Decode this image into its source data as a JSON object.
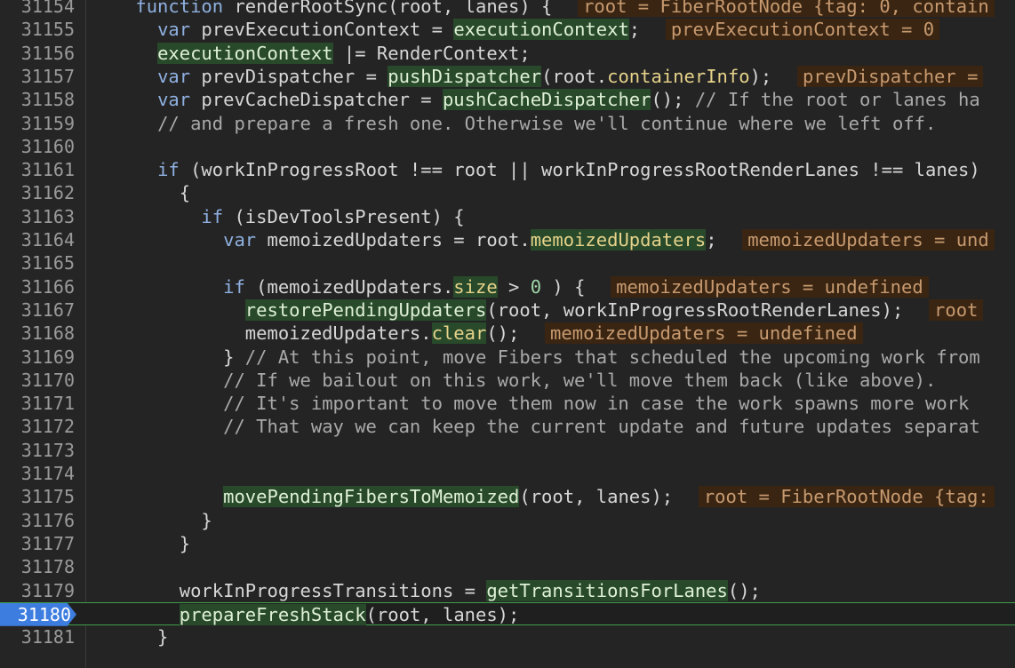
{
  "editor": {
    "current_line": "31180",
    "lines": [
      {
        "n": "31154",
        "segs": [
          [
            "",
            "    "
          ],
          [
            "kw",
            "function"
          ],
          [
            "",
            " renderRootSync(root, lanes) {  "
          ],
          [
            "ann",
            "root = FiberRootNode {tag: 0, contain"
          ]
        ]
      },
      {
        "n": "31155",
        "segs": [
          [
            "",
            "      "
          ],
          [
            "kw",
            "var"
          ],
          [
            "",
            " prevExecutionContext = "
          ],
          [
            "hl",
            "executionContext"
          ],
          [
            "",
            ";  "
          ],
          [
            "ann",
            "prevExecutionContext = 0"
          ]
        ]
      },
      {
        "n": "31156",
        "segs": [
          [
            "",
            "      "
          ],
          [
            "hl",
            "executionContext"
          ],
          [
            "",
            " |= RenderContext;"
          ]
        ]
      },
      {
        "n": "31157",
        "segs": [
          [
            "",
            "      "
          ],
          [
            "kw",
            "var"
          ],
          [
            "",
            " prevDispatcher = "
          ],
          [
            "hl",
            "pushDispatcher"
          ],
          [
            "",
            "(root."
          ],
          [
            "pr",
            "containerInfo"
          ],
          [
            "",
            ");  "
          ],
          [
            "ann",
            "prevDispatcher ="
          ]
        ]
      },
      {
        "n": "31158",
        "segs": [
          [
            "",
            "      "
          ],
          [
            "kw",
            "var"
          ],
          [
            "",
            " prevCacheDispatcher = "
          ],
          [
            "hl",
            "pushCacheDispatcher"
          ],
          [
            "",
            "(); "
          ],
          [
            "cm",
            "// If the root or lanes ha"
          ]
        ]
      },
      {
        "n": "31159",
        "segs": [
          [
            "",
            "      "
          ],
          [
            "cm",
            "// and prepare a fresh one. Otherwise we'll continue where we left off."
          ]
        ]
      },
      {
        "n": "31160",
        "segs": []
      },
      {
        "n": "31161",
        "segs": [
          [
            "",
            "      "
          ],
          [
            "kw",
            "if"
          ],
          [
            "",
            " (workInProgressRoot !== root || workInProgressRootRenderLanes !== lanes)"
          ]
        ]
      },
      {
        "n": "31162",
        "segs": [
          [
            "",
            "        {"
          ]
        ]
      },
      {
        "n": "31163",
        "segs": [
          [
            "",
            "          "
          ],
          [
            "kw",
            "if"
          ],
          [
            "",
            " (isDevToolsPresent) {"
          ]
        ]
      },
      {
        "n": "31164",
        "segs": [
          [
            "",
            "            "
          ],
          [
            "kw",
            "var"
          ],
          [
            "",
            " memoizedUpdaters = root."
          ],
          [
            "hlp",
            "memoizedUpdaters"
          ],
          [
            "",
            ";  "
          ],
          [
            "ann",
            "memoizedUpdaters = und"
          ]
        ]
      },
      {
        "n": "31165",
        "segs": []
      },
      {
        "n": "31166",
        "segs": [
          [
            "",
            "            "
          ],
          [
            "kw",
            "if"
          ],
          [
            "",
            " (memoizedUpdaters."
          ],
          [
            "hlp",
            "size"
          ],
          [
            "",
            " > "
          ],
          [
            "num",
            "0"
          ],
          [
            "",
            " ) {  "
          ],
          [
            "ann",
            "memoizedUpdaters = undefined"
          ]
        ]
      },
      {
        "n": "31167",
        "segs": [
          [
            "",
            "              "
          ],
          [
            "hl",
            "restorePendingUpdaters"
          ],
          [
            "",
            "(root, workInProgressRootRenderLanes);  "
          ],
          [
            "ann",
            "root"
          ]
        ]
      },
      {
        "n": "31168",
        "segs": [
          [
            "",
            "              memoizedUpdaters."
          ],
          [
            "hlp",
            "clear"
          ],
          [
            "",
            "();  "
          ],
          [
            "ann",
            "memoizedUpdaters = undefined"
          ]
        ]
      },
      {
        "n": "31169",
        "segs": [
          [
            "",
            "            } "
          ],
          [
            "cm",
            "// At this point, move Fibers that scheduled the upcoming work from"
          ]
        ]
      },
      {
        "n": "31170",
        "segs": [
          [
            "",
            "            "
          ],
          [
            "cm",
            "// If we bailout on this work, we'll move them back (like above)."
          ]
        ]
      },
      {
        "n": "31171",
        "segs": [
          [
            "",
            "            "
          ],
          [
            "cm",
            "// It's important to move them now in case the work spawns more work"
          ]
        ]
      },
      {
        "n": "31172",
        "segs": [
          [
            "",
            "            "
          ],
          [
            "cm",
            "// That way we can keep the current update and future updates separat"
          ]
        ]
      },
      {
        "n": "31173",
        "segs": []
      },
      {
        "n": "31174",
        "segs": []
      },
      {
        "n": "31175",
        "segs": [
          [
            "",
            "            "
          ],
          [
            "hl",
            "movePendingFibersToMemoized"
          ],
          [
            "",
            "(root, lanes);  "
          ],
          [
            "ann",
            "root = FiberRootNode {tag:"
          ]
        ]
      },
      {
        "n": "31176",
        "segs": [
          [
            "",
            "          }"
          ]
        ]
      },
      {
        "n": "31177",
        "segs": [
          [
            "",
            "        }"
          ]
        ]
      },
      {
        "n": "31178",
        "segs": []
      },
      {
        "n": "31179",
        "segs": [
          [
            "",
            "        workInProgressTransitions = "
          ],
          [
            "hl",
            "getTransitionsForLanes"
          ],
          [
            "",
            "();"
          ]
        ]
      },
      {
        "n": "31180",
        "segs": [
          [
            "",
            "        "
          ],
          [
            "caret",
            ""
          ],
          [
            "hl",
            "prepareFreshStack"
          ],
          [
            "",
            "(root, lanes);"
          ]
        ]
      },
      {
        "n": "31181",
        "segs": [
          [
            "",
            "      }"
          ]
        ]
      }
    ]
  }
}
